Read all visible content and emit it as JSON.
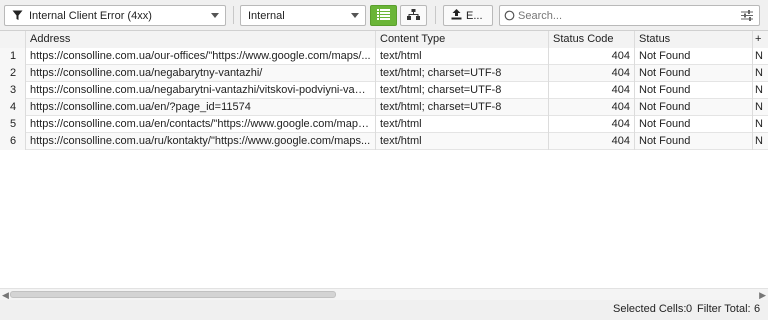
{
  "toolbar": {
    "filter_value": "Internal Client Error (4xx)",
    "scope_value": "Internal",
    "export_label": "E...",
    "search_placeholder": "Search...",
    "accent_color": "#6ab537"
  },
  "table": {
    "headers": {
      "address": "Address",
      "content_type": "Content Type",
      "status_code": "Status Code",
      "status": "Status",
      "more": "+"
    },
    "rows": [
      {
        "n": "1",
        "address": "https://consolline.com.ua/our-offices/\"https://www.google.com/maps/...",
        "content_type": "text/html",
        "status_code": "404",
        "status": "Not Found",
        "more": "N"
      },
      {
        "n": "2",
        "address": "https://consolline.com.ua/negabarytny-vantazhi/",
        "content_type": "text/html; charset=UTF-8",
        "status_code": "404",
        "status": "Not Found",
        "more": "N"
      },
      {
        "n": "3",
        "address": "https://consolline.com.ua/negabarytni-vantazhi/vitskovi-podviyni-vanta...",
        "content_type": "text/html; charset=UTF-8",
        "status_code": "404",
        "status": "Not Found",
        "more": "N"
      },
      {
        "n": "4",
        "address": "https://consolline.com.ua/en/?page_id=11574",
        "content_type": "text/html; charset=UTF-8",
        "status_code": "404",
        "status": "Not Found",
        "more": "N"
      },
      {
        "n": "5",
        "address": "https://consolline.com.ua/en/contacts/\"https://www.google.com/maps...",
        "content_type": "text/html",
        "status_code": "404",
        "status": "Not Found",
        "more": "N"
      },
      {
        "n": "6",
        "address": "https://consolline.com.ua/ru/kontakty/\"https://www.google.com/maps...",
        "content_type": "text/html",
        "status_code": "404",
        "status": "Not Found",
        "more": "N"
      }
    ]
  },
  "status_bar": {
    "selected_label": "Selected Cells:",
    "selected_value": "0",
    "filter_label": "Filter Total:",
    "filter_value": "6"
  }
}
